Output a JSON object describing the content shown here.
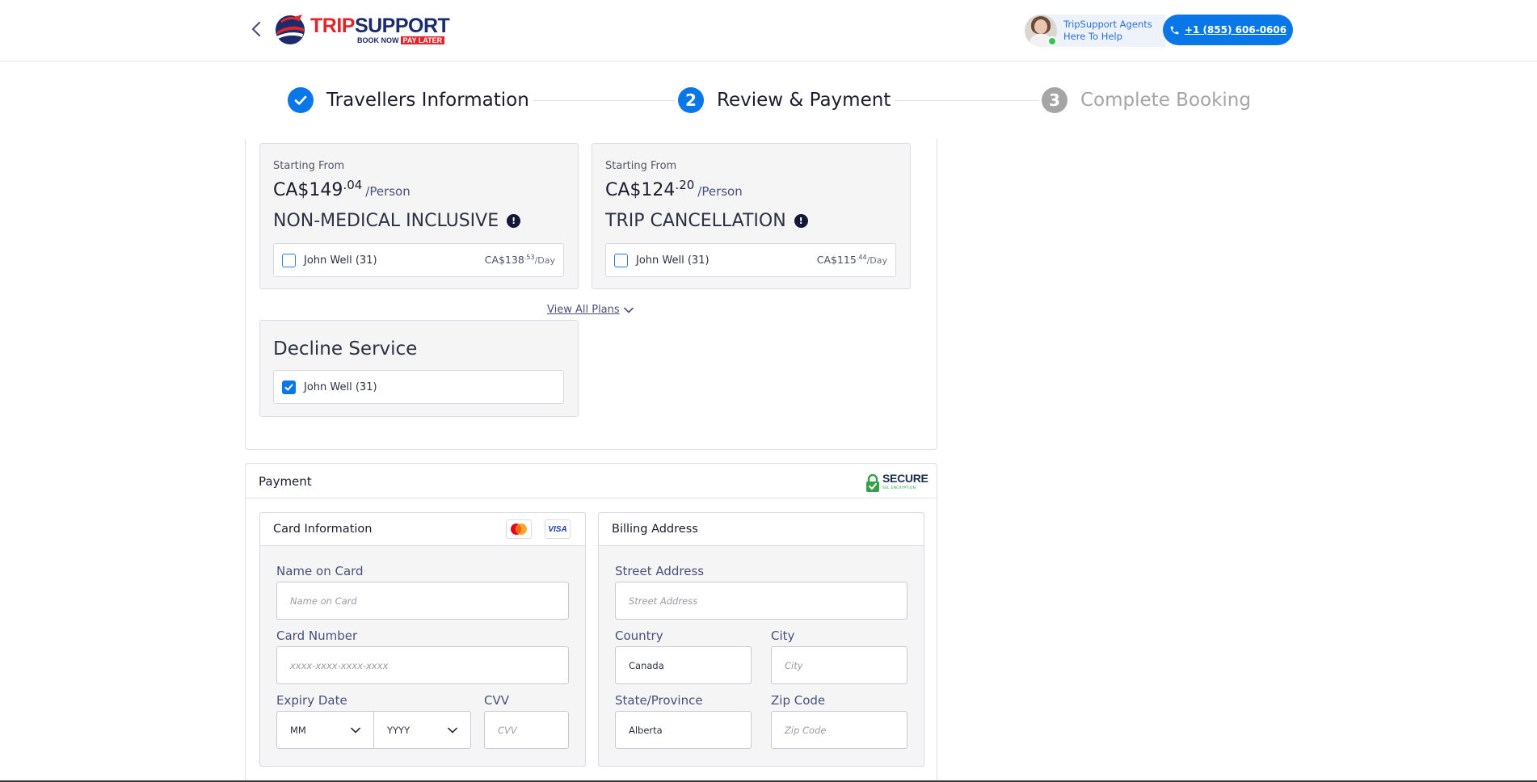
{
  "header": {
    "logo": {
      "word1": "TRIP",
      "word2": "SUPPORT",
      "tagline1": "BOOK NOW",
      "tagline2": "PAY LATER"
    },
    "agents_text_line1": "TripSupport Agents",
    "agents_text_line2": "Here To Help",
    "phone": "+1 (855) 606-0606"
  },
  "stepper": {
    "steps": [
      {
        "number": "1",
        "label": "Travellers Information",
        "state": "done"
      },
      {
        "number": "2",
        "label": "Review & Payment",
        "state": "active"
      },
      {
        "number": "3",
        "label": "Complete Booking",
        "state": "pending"
      }
    ]
  },
  "plans": {
    "items": [
      {
        "starting_from": "Starting From",
        "currency": "CA$",
        "price_whole": "149",
        "price_cents": ".04",
        "per": "/Person",
        "name": "NON-MEDICAL INCLUSIVE",
        "traveller": "John Well (31)",
        "traveller_checked": false,
        "rate_whole": "CA$138",
        "rate_cents": ".53",
        "rate_unit": "/Day"
      },
      {
        "starting_from": "Starting From",
        "currency": "CA$",
        "price_whole": "124",
        "price_cents": ".20",
        "per": "/Person",
        "name": "TRIP CANCELLATION",
        "traveller": "John Well (31)",
        "traveller_checked": false,
        "rate_whole": "CA$115",
        "rate_cents": ".44",
        "rate_unit": "/Day"
      }
    ],
    "view_all": "View All Plans",
    "decline": {
      "title": "Decline Service",
      "traveller": "John Well (31)",
      "traveller_checked": true
    }
  },
  "payment": {
    "title": "Payment",
    "secure_badge": "SECURE",
    "secure_sub": "SSL ENCRYPTION",
    "card": {
      "title": "Card Information",
      "card_brands": [
        "mastercard-icon",
        "visa-icon"
      ],
      "visa_text": "VISA",
      "name_label": "Name on Card",
      "name_placeholder": "Name on Card",
      "number_label": "Card Number",
      "number_placeholder": "xxxx-xxxx-xxxx-xxxx",
      "expiry_label": "Expiry Date",
      "month_value": "MM",
      "year_value": "YYYY",
      "cvv_label": "CVV",
      "cvv_placeholder": "CVV"
    },
    "billing": {
      "title": "Billing Address",
      "street_label": "Street Address",
      "street_placeholder": "Street Address",
      "country_label": "Country",
      "country_value": "Canada",
      "city_label": "City",
      "city_placeholder": "City",
      "state_label": "State/Province",
      "state_value": "Alberta",
      "zip_label": "Zip Code",
      "zip_placeholder": "Zip Code"
    }
  },
  "colors": {
    "primary": "#0a77e8",
    "brand_red": "#e0262b",
    "brand_navy": "#1b2b6b",
    "pending_gray": "#a5a5a5",
    "secure_green": "#35a04a"
  }
}
